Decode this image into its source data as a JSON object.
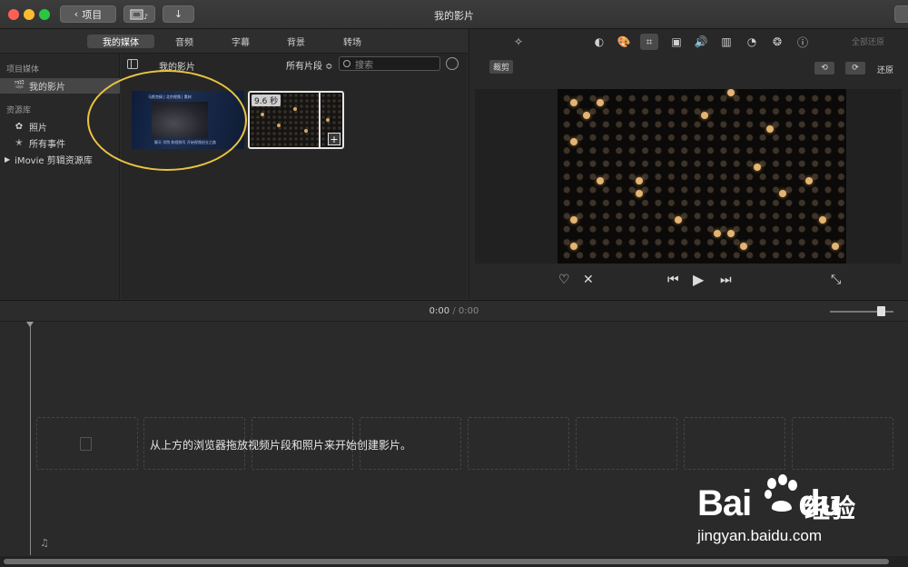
{
  "window": {
    "title": "我的影片",
    "back_label": "项目"
  },
  "tabs": [
    {
      "label": "我的媒体",
      "active": true
    },
    {
      "label": "音频",
      "active": false
    },
    {
      "label": "字幕",
      "active": false
    },
    {
      "label": "背景",
      "active": false
    },
    {
      "label": "转场",
      "active": false
    }
  ],
  "sidebar": {
    "section1": "项目媒体",
    "project_item": "我的影片",
    "section2": "资源库",
    "photos": "照片",
    "all_events": "所有事件",
    "imovie_library": "iMovie 剪辑资源库"
  },
  "browser": {
    "title": "我的影片",
    "filter": "所有片段 ≎",
    "search_placeholder": "搜索",
    "clip2_duration": "9.6 秒",
    "clip1_caption": "马斯克搞 | 北京视频 | 素材",
    "clip1_subcaption": "聊天 学院 和视频号 开始视频创业之路",
    "highlight_color": "#e9c340"
  },
  "viewer": {
    "reset_all": "全部还原",
    "crop_label": "裁剪",
    "restore": "还原",
    "toolbar_icons": [
      "magic-wand-icon",
      "color-balance-icon",
      "palette-icon",
      "crop-icon",
      "camera-icon",
      "volume-icon",
      "equalizer-icon",
      "speed-icon",
      "filter-icon",
      "info-icon"
    ]
  },
  "timeline": {
    "current": "0:00",
    "separator": "/",
    "total": "0:00",
    "hint": "从上方的浏览器拖放视频片段和照片来开始创建影片。"
  },
  "watermark": {
    "logo": "Bai",
    "logo_tail": "du",
    "cn": "经验",
    "url": "jingyan.baidu.com"
  }
}
